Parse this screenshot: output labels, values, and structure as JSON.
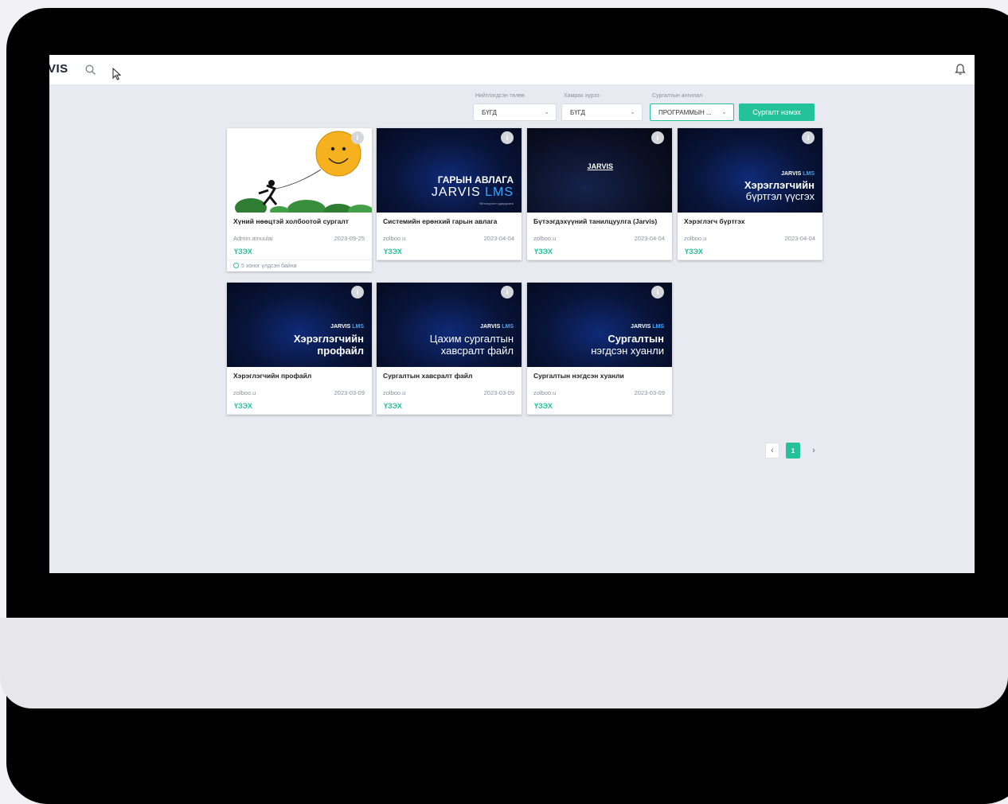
{
  "app": {
    "logo_text": "VIS",
    "icons": {
      "search": "search-icon",
      "cursor": "cursor-icon",
      "bell": "bell-icon"
    }
  },
  "filters": {
    "published": {
      "label": "Нийтлэгдсэн төлөв",
      "value": "БҮГД"
    },
    "coverage": {
      "label": "Хамрах хүрээ",
      "value": "БҮГД"
    },
    "category": {
      "label": "Сургалтын ангилал",
      "value": "ПРОГРАММЫН ..."
    },
    "add_button": "Сургалт нэмэх"
  },
  "courses": [
    {
      "title": "Хүний нөөцтэй холбоотой сургалт",
      "author": "Admin.amuulai",
      "date": "2023-09-25",
      "action": "ҮЗЭХ",
      "remaining": "5 хоног үлдсэн байна",
      "thumb_style": "illustration"
    },
    {
      "title": "Системийн ерөнхий гарын авлага",
      "author": "zolboo.u",
      "date": "2023-04-04",
      "action": "ҮЗЭХ",
      "thumb_style": "dark",
      "thumb_heading": "ГАРЫН АВЛАГА",
      "thumb_brand": "JARVIS",
      "thumb_brand_accent": "LMS",
      "thumb_sub": "Үйлчлүүлэгч удирдлага"
    },
    {
      "title": "Бүтээгдэхүүний танилцуулга (Jarvis)",
      "author": "zolboo.u",
      "date": "2023-04-04",
      "action": "ҮЗЭХ",
      "thumb_style": "dark2",
      "thumb_heading": "JARVIS"
    },
    {
      "title": "Хэрэглэгч бүртгэх",
      "author": "zolboo.u",
      "date": "2023-04-04",
      "action": "ҮЗЭХ",
      "thumb_style": "dark",
      "thumb_brand": "JARVIS",
      "thumb_brand_accent": "LMS",
      "thumb_line1": "Хэрэглэгчийн",
      "thumb_line2": "бүртгэл үүсгэх"
    },
    {
      "title": "Хэрэглэгчийн профайл",
      "author": "zolboo.u",
      "date": "2023-03-09",
      "action": "ҮЗЭХ",
      "thumb_style": "dark",
      "thumb_brand": "JARVIS",
      "thumb_brand_accent": "LMS",
      "thumb_line1": "Хэрэглэгчийн",
      "thumb_line2": "профайл"
    },
    {
      "title": "Сургалтын хавсралт файл",
      "author": "zolboo.u",
      "date": "2023-03-09",
      "action": "ҮЗЭХ",
      "thumb_style": "dark",
      "thumb_brand": "JARVIS",
      "thumb_brand_accent": "LMS",
      "thumb_line1": "Цахим сургалтын",
      "thumb_line2": "хавсралт файл"
    },
    {
      "title": "Сургалтын нэгдсэн хуанли",
      "author": "zolboo.u",
      "date": "2023-03-09",
      "action": "ҮЗЭХ",
      "thumb_style": "dark",
      "thumb_brand": "JARVIS",
      "thumb_brand_accent": "LMS",
      "thumb_line1": "Сургалтын",
      "thumb_line2": "нэгдсэн хуанли"
    }
  ],
  "pagination": {
    "prev": "‹",
    "current": "1",
    "next": "›"
  }
}
